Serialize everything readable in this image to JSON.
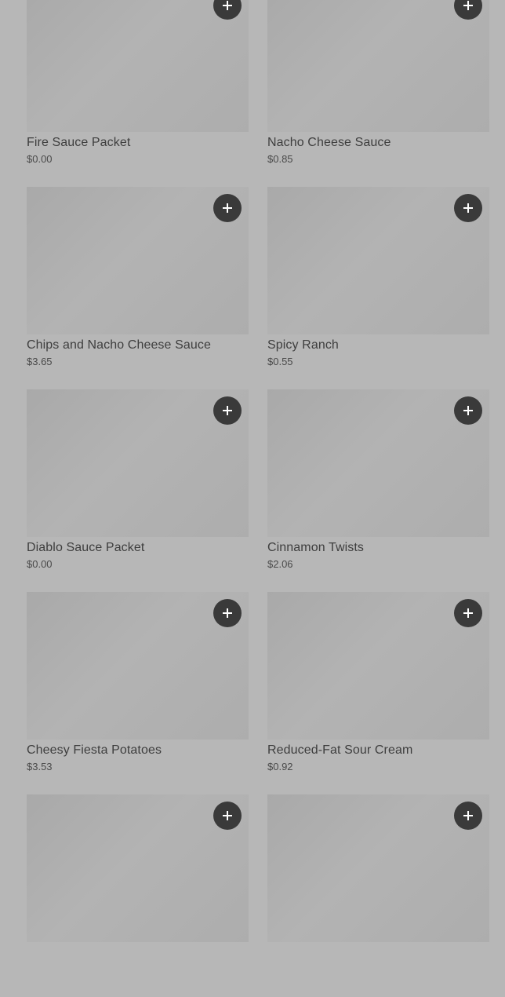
{
  "menu": {
    "items": [
      {
        "name": "Fire Sauce Packet",
        "price": "$0.00"
      },
      {
        "name": "Nacho Cheese Sauce",
        "price": "$0.85"
      },
      {
        "name": "Chips and Nacho Cheese Sauce",
        "price": "$3.65"
      },
      {
        "name": "Spicy Ranch",
        "price": "$0.55"
      },
      {
        "name": "Diablo Sauce Packet",
        "price": "$0.00"
      },
      {
        "name": "Cinnamon Twists",
        "price": "$2.06"
      },
      {
        "name": "Cheesy Fiesta Potatoes",
        "price": "$3.53"
      },
      {
        "name": "Reduced-Fat Sour Cream",
        "price": "$0.92"
      },
      {
        "name": "",
        "price": ""
      },
      {
        "name": "",
        "price": ""
      }
    ],
    "add_icon": "plus-icon",
    "colors": {
      "background": "#b7b7b7",
      "button": "#3a3a3a",
      "text": "#3e3e3e"
    }
  }
}
